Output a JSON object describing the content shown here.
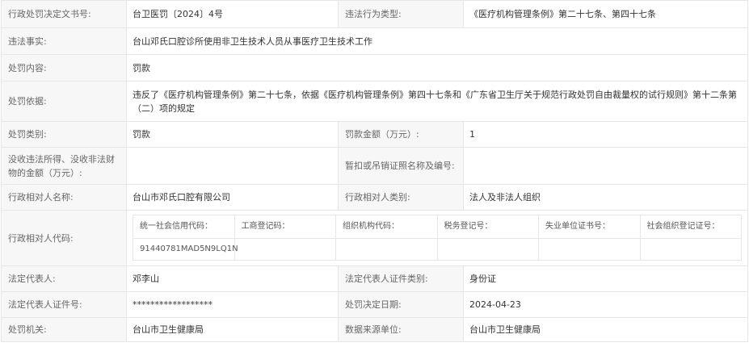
{
  "rows": {
    "decision_no": {
      "label": "行政处罚决定文书号:",
      "value": "台卫医罚〔2024〕4号"
    },
    "violation_type": {
      "label": "违法行为类型:",
      "value": "《医疗机构管理条例》第二十七条、第四十七条"
    },
    "violation_fact": {
      "label": "违法事实:",
      "value": "台山邓氏口腔诊所使用非卫生技术人员从事医疗卫生技术工作"
    },
    "penalty_content": {
      "label": "处罚内容:",
      "value": "罚款"
    },
    "penalty_basis": {
      "label": "处罚依据:",
      "value": "违反了《医疗机构管理条例》第二十七条，依据《医疗机构管理条例》第四十七条和《广东省卫生厅关于规范行政处罚自由裁量权的试行规则》第十二条第（二）项的规定"
    },
    "penalty_category": {
      "label": "处罚类别:",
      "value": "罚款"
    },
    "fine_amount": {
      "label": "罚款金额（万元）:",
      "value": "1"
    },
    "confiscated_amount": {
      "label": "没收违法所得、没收非法财物的金额（万元）:",
      "value": ""
    },
    "suspended_license": {
      "label": "暂扣或吊销证照名称及编号:",
      "value": ""
    },
    "party_name": {
      "label": "行政相对人名称:",
      "value": "台山市邓氏口腔有限公司"
    },
    "party_category": {
      "label": "行政相对人类别:",
      "value": "法人及非法人组织"
    },
    "party_code": {
      "label": "行政相对人代码:"
    },
    "legal_rep": {
      "label": "法定代表人:",
      "value": "邓李山"
    },
    "legal_rep_id_type": {
      "label": "法定代表人证件类别:",
      "value": "身份证"
    },
    "legal_rep_id_no": {
      "label": "法定代表人证件号:",
      "value": "******************"
    },
    "decision_date": {
      "label": "处罚决定日期:",
      "value": "2024-04-23"
    },
    "authority": {
      "label": "处罚机关:",
      "value": "台山市卫生健康局"
    },
    "data_source": {
      "label": "数据来源单位:",
      "value": "台山市卫生健康局"
    }
  },
  "codes": {
    "headers": [
      "统一社会信用代码：",
      "工商登记码：",
      "组织机构代码：",
      "税务登记号：",
      "失业单位证书号：",
      "社会组织登记证号："
    ],
    "values": [
      "91440781MAD5N9LQ1N",
      "",
      "",
      "",
      "",
      ""
    ]
  }
}
